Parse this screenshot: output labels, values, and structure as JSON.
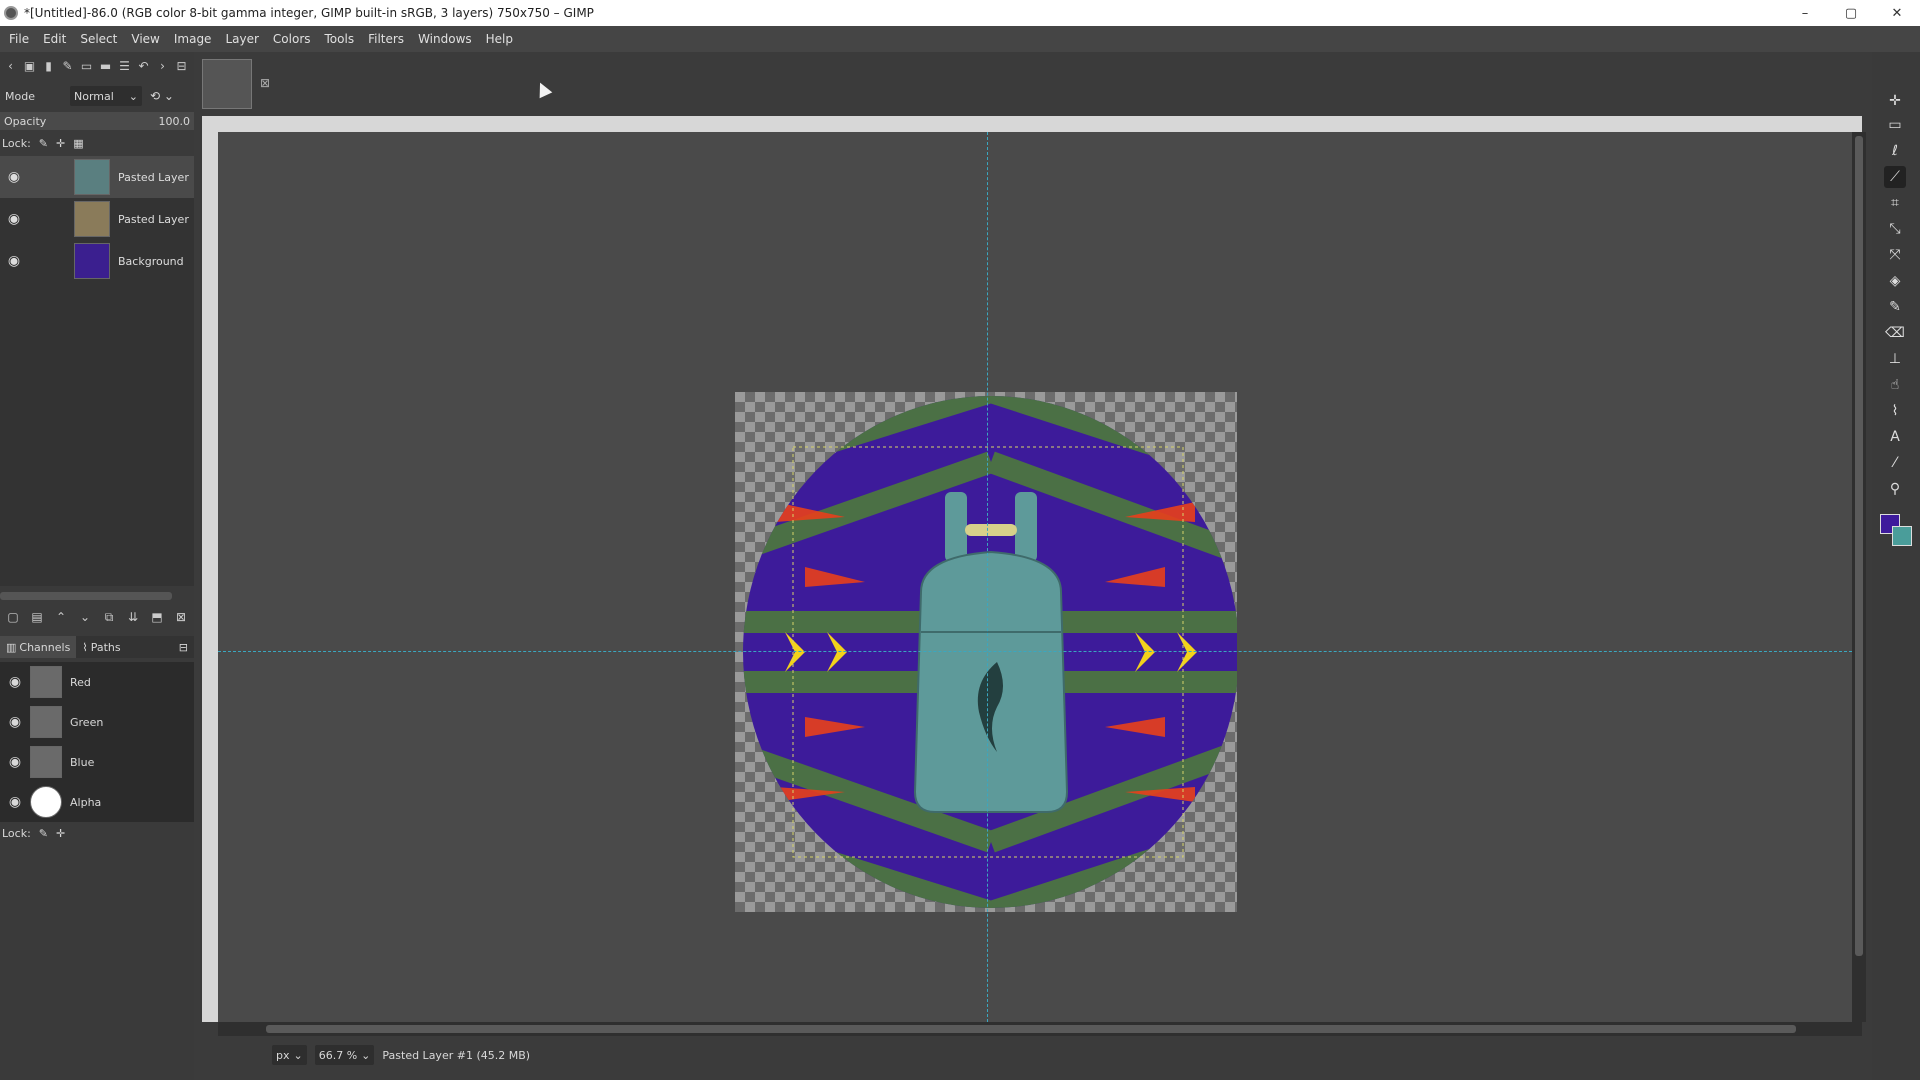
{
  "window": {
    "title": "*[Untitled]-86.0 (RGB color 8-bit gamma integer, GIMP built-in sRGB, 3 layers) 750x750 – GIMP",
    "minimize": "–",
    "maximize": "▢",
    "close": "✕"
  },
  "menu": [
    "File",
    "Edit",
    "Select",
    "View",
    "Image",
    "Layer",
    "Colors",
    "Tools",
    "Filters",
    "Windows",
    "Help"
  ],
  "layers_panel": {
    "mode_label": "Mode",
    "mode_value": "Normal",
    "opacity_label": "Opacity",
    "opacity_value": "100.0",
    "lock_label": "Lock:",
    "layers": [
      {
        "name": "Pasted Layer",
        "selected": true,
        "thumb_color": "#5a7f80"
      },
      {
        "name": "Pasted Layer",
        "selected": false,
        "thumb_color": "#8a7b5a"
      },
      {
        "name": "Background",
        "selected": false,
        "thumb_color": "#3b1f8f"
      }
    ]
  },
  "tabs": {
    "channels": "Channels",
    "paths": "Paths"
  },
  "channels": [
    {
      "name": "Red",
      "thumb_color": "#6a6a6a"
    },
    {
      "name": "Green",
      "thumb_color": "#6a6a6a"
    },
    {
      "name": "Blue",
      "thumb_color": "#6a6a6a"
    },
    {
      "name": "Alpha",
      "thumb_color": "#ffffff"
    }
  ],
  "channels_lock_label": "Lock:",
  "status": {
    "unit": "px",
    "zoom": "66.7 %",
    "layer_info": "Pasted Layer #1 (45.2 MB)"
  },
  "colors": {
    "foreground": "#3e1b9c",
    "background": "#4a9d9a",
    "guide": "#3aa7c0"
  }
}
